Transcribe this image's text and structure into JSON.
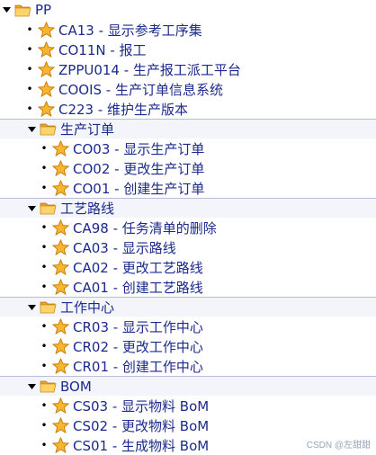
{
  "root": {
    "label": "PP",
    "items": [
      {
        "code": "CA13",
        "desc": "显示参考工序集",
        "text": "CA13 - 显示参考工序集"
      },
      {
        "code": "CO11N",
        "desc": "报工",
        "text": "CO11N - 报工"
      },
      {
        "code": "ZPPU014",
        "desc": "生产报工派工平台",
        "text": "ZPPU014 - 生产报工派工平台"
      },
      {
        "code": "COOIS",
        "desc": "生产订单信息系统",
        "text": "COOIS - 生产订单信息系统"
      },
      {
        "code": "C223",
        "desc": "维护生产版本",
        "text": "C223 - 维护生产版本"
      }
    ]
  },
  "folders": [
    {
      "label": "生产订单",
      "items": [
        {
          "text": "CO03 - 显示生产订单"
        },
        {
          "text": "CO02 - 更改生产订单"
        },
        {
          "text": "CO01 - 创建生产订单"
        }
      ]
    },
    {
      "label": "工艺路线",
      "items": [
        {
          "text": "CA98 - 任务清单的删除"
        },
        {
          "text": "CA03 - 显示路线"
        },
        {
          "text": "CA02 - 更改工艺路线"
        },
        {
          "text": "CA01 - 创建工艺路线"
        }
      ]
    },
    {
      "label": "工作中心",
      "items": [
        {
          "text": "CR03 - 显示工作中心"
        },
        {
          "text": "CR02 - 更改工作中心"
        },
        {
          "text": "CR01 - 创建工作中心"
        }
      ]
    },
    {
      "label": "BOM",
      "items": [
        {
          "text": "CS03 - 显示物料 BoM"
        },
        {
          "text": "CS02 - 更改物料 BoM"
        },
        {
          "text": "CS01 - 生成物料 BoM"
        }
      ]
    }
  ],
  "watermark": "CSDN @左甜甜",
  "icons": {
    "folder": "folder-open-icon",
    "favorite": "star-icon",
    "toggle": "expand-triangle-icon"
  },
  "colors": {
    "label": "#1b2a8c",
    "folder": "#f3b23a",
    "star": "#f5a623",
    "separator": "#b4bfd6"
  }
}
